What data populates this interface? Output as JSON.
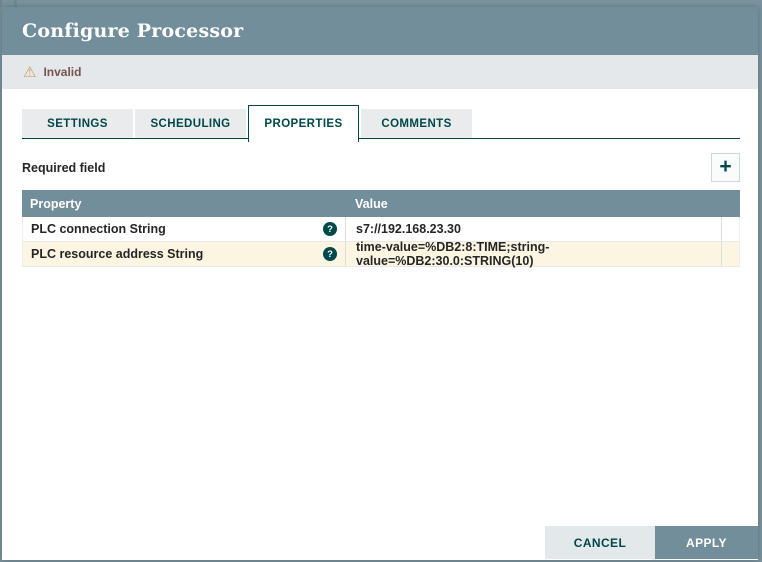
{
  "dialog": {
    "title": "Configure Processor"
  },
  "status": {
    "label": "Invalid"
  },
  "icons": {
    "warning": "⚠",
    "plus": "+",
    "help": "?"
  },
  "tabs": [
    {
      "label": "SETTINGS"
    },
    {
      "label": "SCHEDULING"
    },
    {
      "label": "PROPERTIES"
    },
    {
      "label": "COMMENTS"
    }
  ],
  "properties_panel": {
    "required_label": "Required field",
    "table": {
      "columns": [
        "Property",
        "Value"
      ],
      "rows": [
        {
          "property": "PLC connection String",
          "value": "s7://192.168.23.30"
        },
        {
          "property": "PLC resource address String",
          "value": "time-value=%DB2:8:TIME;string-value=%DB2:30.0:STRING(10)"
        }
      ]
    }
  },
  "footer": {
    "cancel_label": "CANCEL",
    "apply_label": "APPLY"
  },
  "colors": {
    "titlebar": "#728e9b",
    "backdrop": "#7b939e",
    "status_bar_bg": "#e4e8ea",
    "status_text": "#775351",
    "warning_icon": "#cf9f5d",
    "teal_accent": "#004849",
    "table_header_bg": "#728e9b",
    "row_highlight_bg": "#fbf5e2",
    "cancel_bg": "#e3e8eb",
    "apply_bg": "#728e9b"
  }
}
